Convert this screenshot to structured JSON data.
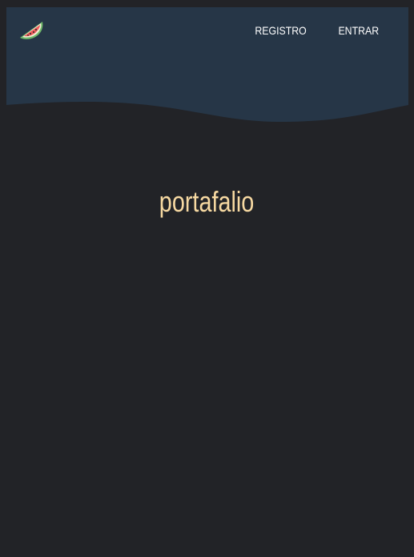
{
  "colors": {
    "background": "#222327",
    "header": "#263647",
    "title": "#f7d9a2",
    "nav_text": "#ffffff"
  },
  "header": {
    "logo_icon": "watermelon-icon",
    "nav": {
      "register_label": "REGISTRO",
      "login_label": "ENTRAR"
    }
  },
  "main": {
    "title": "portafalio"
  }
}
